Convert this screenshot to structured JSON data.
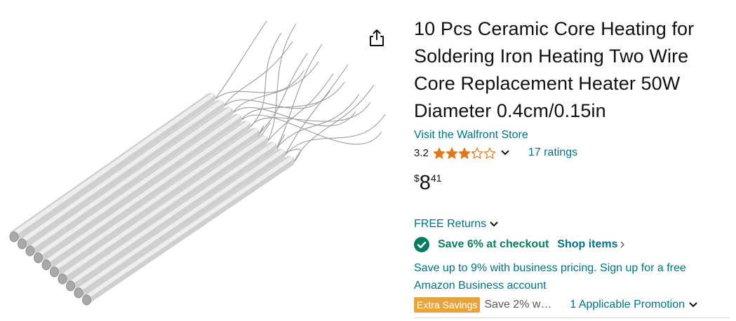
{
  "product": {
    "title": "10 Pcs Ceramic Core Heating for Soldering Iron Heating Two Wire Core Replacement Heater 50W Diameter 0.4cm/0.15in",
    "store_link": "Visit the Walfront Store",
    "rating": "3.2",
    "ratings_count": "17 ratings",
    "stars_filled": 3.2,
    "stars_total": 5
  },
  "price": {
    "symbol": "$",
    "whole": "8",
    "fraction": "41"
  },
  "returns": {
    "label": "FREE Returns"
  },
  "checkout_savings": {
    "label": "Save 6% at checkout",
    "link": "Shop items"
  },
  "business": {
    "text": "Save up to 9% with business pricing. Sign up for a free Amazon Business account"
  },
  "promotion": {
    "badge": "Extra Savings",
    "description": "Save 2% w…",
    "link": "1 Applicable Promotion"
  },
  "icons": {
    "share": "share-icon",
    "star": "star-icon",
    "chevron": "chevron-down-icon",
    "check": "check-circle-icon"
  },
  "colors": {
    "link": "#007185",
    "star": "#DE7921",
    "success": "#067D62",
    "badge": "#E7A33E",
    "text": "#0F1111"
  }
}
